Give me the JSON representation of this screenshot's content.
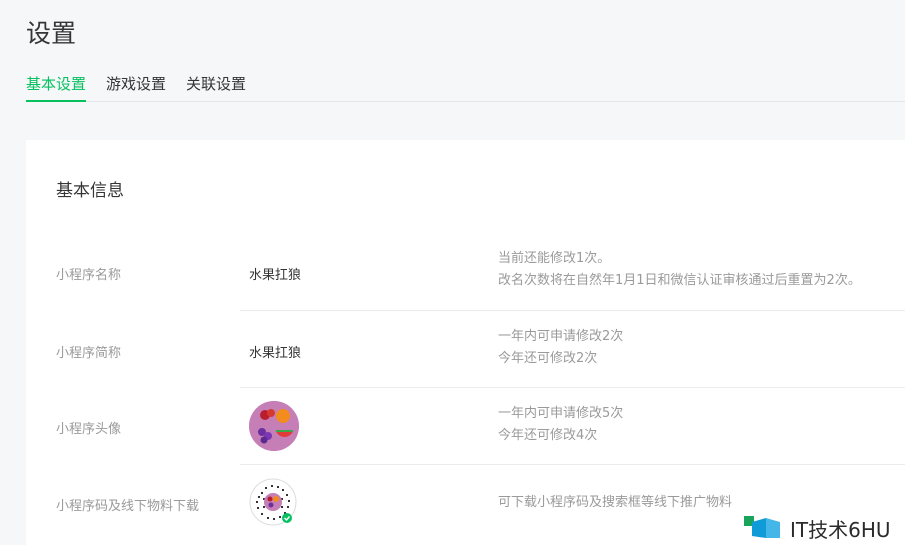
{
  "page": {
    "title": "设置"
  },
  "tabs": [
    {
      "label": "基本设置",
      "active": true
    },
    {
      "label": "游戏设置",
      "active": false
    },
    {
      "label": "关联设置",
      "active": false
    }
  ],
  "section": {
    "title": "基本信息"
  },
  "rows": [
    {
      "label": "小程序名称",
      "value": "水果扛狼",
      "note_lines": [
        "当前还能修改1次。",
        "改名次数将在自然年1月1日和微信认证审核通过后重置为2次。"
      ]
    },
    {
      "label": "小程序简称",
      "value": "水果扛狼",
      "note_lines": [
        "一年内可申请修改2次",
        "今年还可修改2次"
      ]
    },
    {
      "label": "小程序头像",
      "value_icon": "fruit-avatar-icon",
      "note_lines": [
        "一年内可申请修改5次",
        "今年还可修改4次"
      ]
    },
    {
      "label": "小程序码及线下物料下载",
      "value_icon": "mini-program-code-icon",
      "note_lines": [
        "可下载小程序码及搜索框等线下推广物料"
      ]
    }
  ],
  "watermark": {
    "text": "IT技术6HU"
  },
  "colors": {
    "accent": "#07c160",
    "background": "#f6f7f9"
  }
}
